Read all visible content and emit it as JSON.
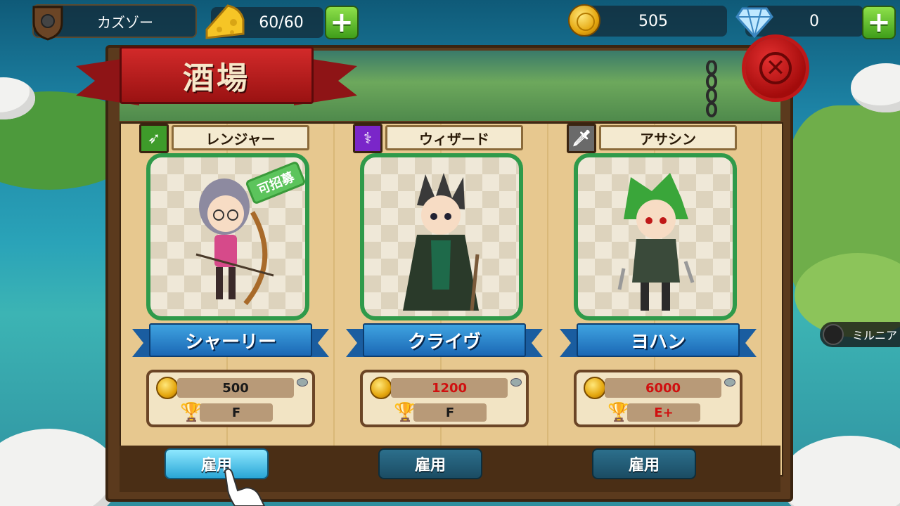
{
  "player": {
    "name": "カズゾー"
  },
  "resources": {
    "stamina": "60/60",
    "gold": "505",
    "gems": "0"
  },
  "window": {
    "title": "酒場"
  },
  "side_location": {
    "label": "ミルニア"
  },
  "cards": [
    {
      "class": "レンジャー",
      "class_color": "#3e9b2a",
      "name": "シャーリー",
      "price": "500",
      "price_color": "#1a1a1a",
      "rank": "F",
      "rank_color": "#1a1a1a",
      "badge": "可招募",
      "hire_label": "雇用"
    },
    {
      "class": "ウィザード",
      "class_color": "#7a26c9",
      "name": "クライヴ",
      "price": "1200",
      "price_color": "#d01010",
      "rank": "F",
      "rank_color": "#1a1a1a",
      "hire_label": "雇用"
    },
    {
      "class": "アサシン",
      "class_color": "#6a6a6a",
      "name": "ヨハン",
      "price": "6000",
      "price_color": "#d01010",
      "rank": "E+",
      "rank_color": "#d01010",
      "hire_label": "雇用"
    }
  ],
  "icons": {
    "profile": "shield-icon",
    "stamina": "cheese-icon",
    "gold": "coin-icon",
    "gems": "diamond-icon",
    "add": "plus-icon",
    "close": "wax-seal-close-icon",
    "rank": "trophy-icon",
    "ranger": "arrow-icon",
    "wizard": "staff-icon",
    "assassin": "dagger-icon"
  }
}
